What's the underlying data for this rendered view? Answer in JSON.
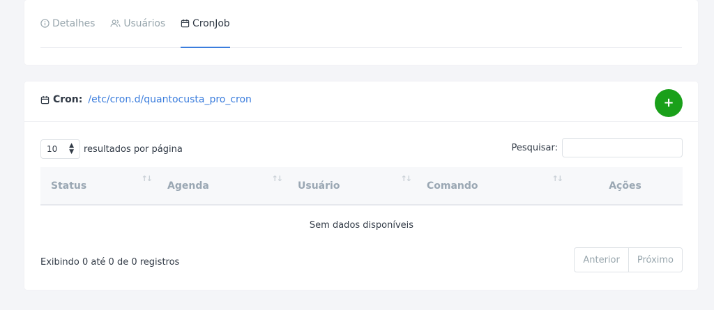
{
  "tabs": [
    {
      "label": "Detalhes",
      "icon": "info-circle-icon",
      "active": false
    },
    {
      "label": "Usuários",
      "icon": "users-icon",
      "active": false
    },
    {
      "label": "CronJob",
      "icon": "calendar-icon",
      "active": true
    }
  ],
  "cron": {
    "label": "Cron:",
    "path": "/etc/cron.d/quantocusta_pro_cron",
    "add_label": "+"
  },
  "table_controls": {
    "page_length": "10",
    "page_length_suffix": "resultados por página",
    "search_label": "Pesquisar:",
    "search_value": ""
  },
  "table": {
    "columns": [
      "Status",
      "Agenda",
      "Usuário",
      "Comando",
      "Ações"
    ],
    "empty_text": "Sem dados disponíveis"
  },
  "footer": {
    "info": "Exibindo 0 até 0 de 0 registros",
    "prev_label": "Anterior",
    "next_label": "Próximo"
  },
  "colors": {
    "accent": "#3b7ddd",
    "add_button": "#1aa01a",
    "background": "#f4f5f8"
  }
}
